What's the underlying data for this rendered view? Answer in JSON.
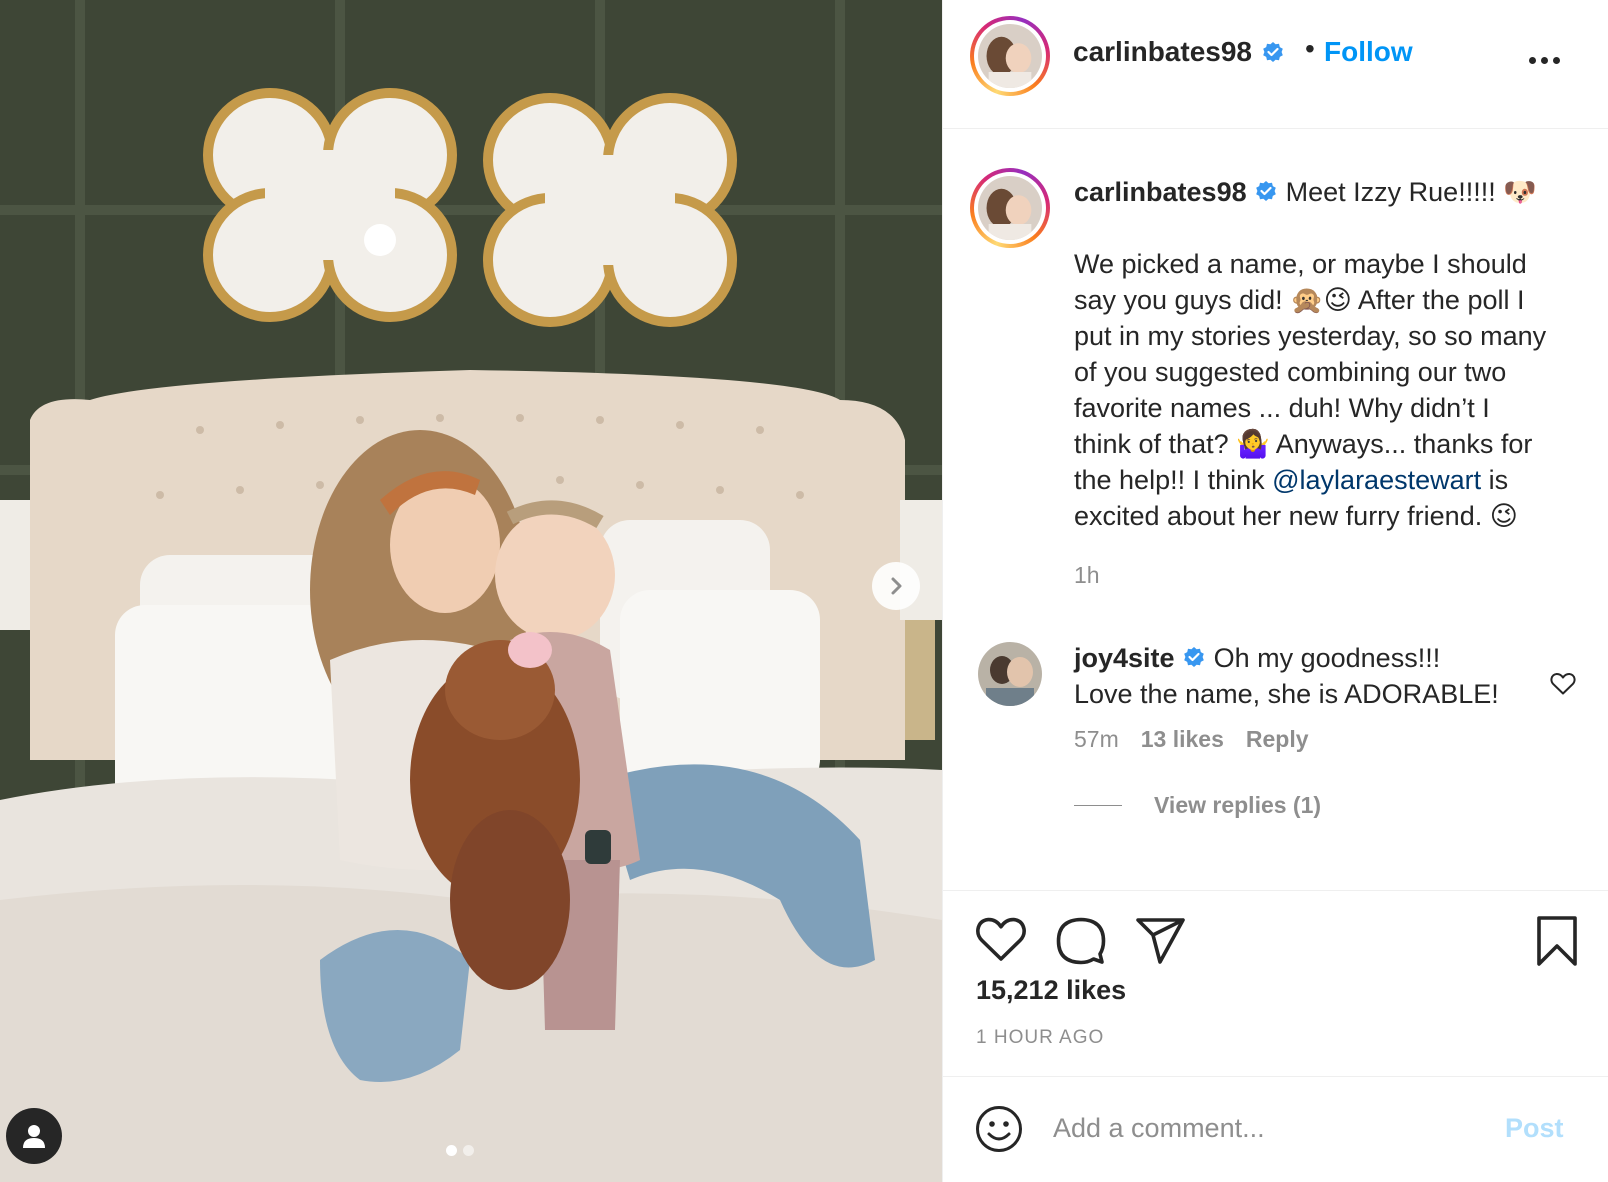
{
  "post": {
    "username": "carlinbates98",
    "follow_label": "Follow",
    "separator": "•",
    "verified_icon": "verified-badge-icon",
    "more_icon": "more-options-icon"
  },
  "caption": {
    "username": "carlinbates98",
    "lines": [
      "Meet Izzy Rue!!!!! 🐶",
      "",
      "We picked a name, or maybe I should",
      "say you guys did! 🙊😉 After the poll I",
      "put in my stories yesterday, so so many",
      "of you suggested combining our two",
      "favorite names ... duh! Why didn’t I",
      "think of that? 🤷‍♀️ Anyways... thanks for",
      "the help!! I think ",
      "excited about her new furry friend. 😉"
    ],
    "mention": "@laylaraestewart",
    "after_mention": " is",
    "time": "1h"
  },
  "comment": {
    "username": "joy4site",
    "text_1": "Oh my goodness!!!",
    "text_2": "Love the name, she is ADORABLE!",
    "time": "57m",
    "likes": "13 likes",
    "reply_label": "Reply",
    "view_replies": "View replies (1)"
  },
  "actions": {
    "likes": "15,212 likes",
    "time_ago": "1 HOUR AGO"
  },
  "add_comment": {
    "placeholder": "Add a comment...",
    "post_label": "Post"
  },
  "carousel": {
    "current": 1,
    "total": 2
  },
  "colors": {
    "accent": "#0095f6",
    "verified": "#3897f0",
    "muted": "#8e8e8e",
    "text": "#262626",
    "post_disabled": "#b2dffc"
  }
}
